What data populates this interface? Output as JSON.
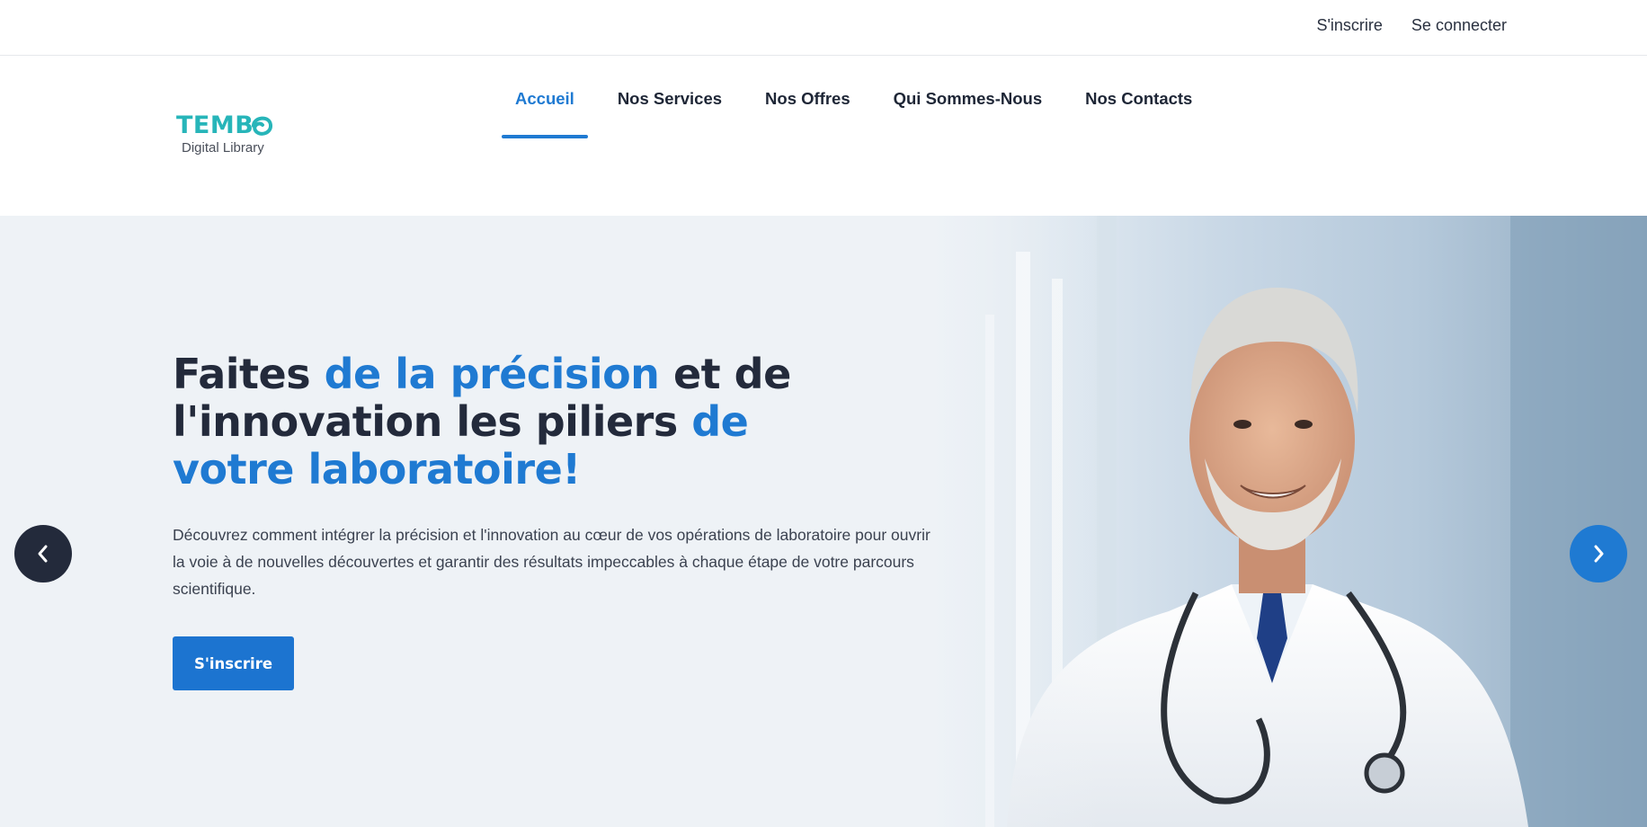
{
  "topbar": {
    "signup_label": "S'inscrire",
    "login_label": "Se connecter"
  },
  "logo": {
    "wordmark": "TEMB",
    "subtitle": "Digital Library"
  },
  "nav": {
    "items": [
      {
        "label": "Accueil",
        "active": true
      },
      {
        "label": "Nos Services",
        "active": false
      },
      {
        "label": "Nos Offres",
        "active": false
      },
      {
        "label": "Qui Sommes-Nous",
        "active": false
      },
      {
        "label": "Nos Contacts",
        "active": false
      }
    ]
  },
  "hero": {
    "title_parts": [
      "Faites ",
      "de la précision",
      " et de l'innovation les piliers ",
      "de votre laboratoire!"
    ],
    "description": "Découvrez comment intégrer la précision et l'innovation au cœur de vos opérations de laboratoire pour ouvrir la voie à de nouvelles découvertes et garantir des résultats impeccables à chaque étape de votre parcours scientifique.",
    "cta_label": "S'inscrire",
    "prev_icon": "chevron-left-icon",
    "next_icon": "chevron-right-icon"
  },
  "colors": {
    "accent": "#1f7ad2",
    "dark": "#232a3b",
    "logo": "#27b5b9"
  }
}
